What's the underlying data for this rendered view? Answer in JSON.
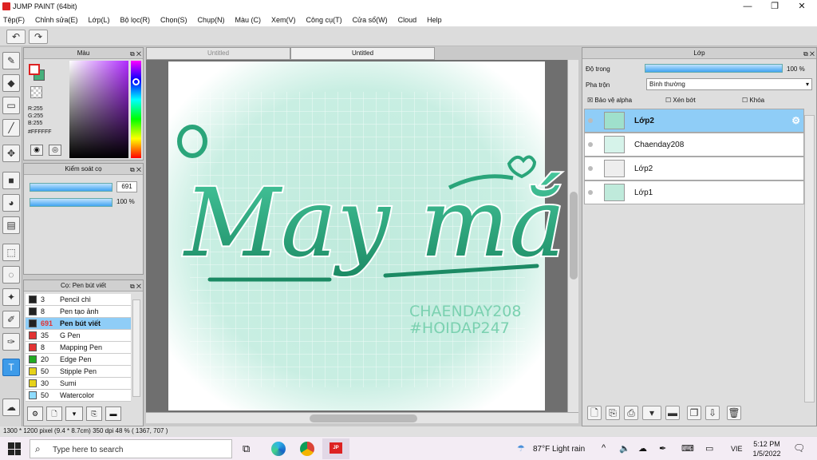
{
  "window": {
    "title": "JUMP PAINT (64bit)"
  },
  "menu": [
    "Tệp(F)",
    "Chỉnh sửa(E)",
    "Lớp(L)",
    "Bộ lọc(R)",
    "Chọn(S)",
    "Chụp(N)",
    "Màu (C)",
    "Xem(V)",
    "Công cụ(T)",
    "Cửa sổ(W)",
    "Cloud",
    "Help"
  ],
  "color_panel": {
    "title": "Màu",
    "r": "R:255",
    "g": "G:255",
    "b": "B:255",
    "hex": "#FFFFFF",
    "fg_color": "#ffffff",
    "bg_color": "#45b07c"
  },
  "brush_control": {
    "title": "Kiểm soát cọ",
    "size": "691",
    "opacity": "100 %",
    "size_level": 0.97,
    "opacity_level": 1.0
  },
  "brush_list": {
    "title": "Cọ: Pen bút viết",
    "items": [
      {
        "color": "#222222",
        "num": "3",
        "name": "Pencil chì"
      },
      {
        "color": "#222222",
        "num": "8",
        "name": "Pen tạo ảnh"
      },
      {
        "color": "#222222",
        "num": "691",
        "name": "Pen bút viết",
        "selected": true
      },
      {
        "color": "#e23333",
        "num": "35",
        "name": "G Pen"
      },
      {
        "color": "#e23333",
        "num": "8",
        "name": "Mapping Pen"
      },
      {
        "color": "#22aa22",
        "num": "20",
        "name": "Edge Pen"
      },
      {
        "color": "#e6d21a",
        "num": "50",
        "name": "Stipple Pen"
      },
      {
        "color": "#e6d21a",
        "num": "30",
        "name": "Sumi"
      },
      {
        "color": "#8fdcff",
        "num": "50",
        "name": "Watercolor"
      }
    ]
  },
  "tabs": [
    "Untitled",
    "Untitled"
  ],
  "artwork": {
    "title_text": "May mắn",
    "line1": "CHAENDAY208",
    "line2": "#HOIDAP247"
  },
  "layers_panel": {
    "title": "Lớp",
    "opacity_label": "Độ trong",
    "opacity_value": "100 %",
    "blend_label": "Pha trộn",
    "blend_value": "Bình thường",
    "alpha_protect": "Bảo vệ alpha",
    "clip": "Xén bớt",
    "lock": "Khóa",
    "layers": [
      {
        "name": "Lớp2",
        "selected": true,
        "thumb": "#9fe0cc"
      },
      {
        "name": "Chaenday208",
        "selected": false,
        "thumb": "#d6f3ea"
      },
      {
        "name": "Lớp2",
        "selected": false,
        "thumb": "#eeeeee"
      },
      {
        "name": "Lớp1",
        "selected": false,
        "thumb": "#bfeadb"
      }
    ]
  },
  "status": {
    "text": "1300 * 1200 pixel  (9.4 * 8.7cm)  350 dpi  48 %  ( 1367, 707 )"
  },
  "taskbar": {
    "search_placeholder": "Type here to search",
    "weather": "87°F  Light rain",
    "lang": "VIE",
    "time": "5:12 PM",
    "date": "1/5/2022"
  }
}
